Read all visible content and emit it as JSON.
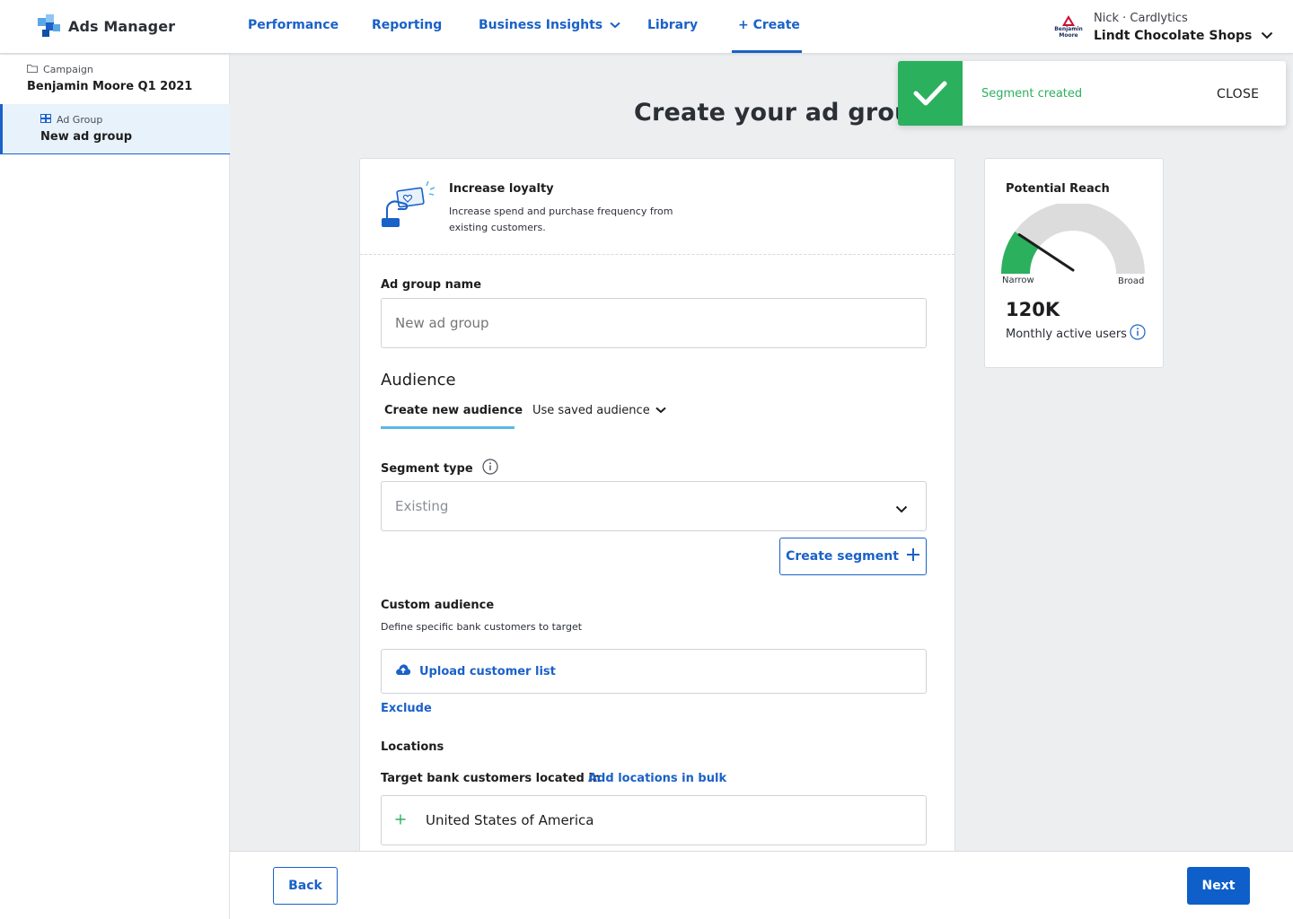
{
  "app": {
    "title": "Ads Manager"
  },
  "nav": {
    "items": [
      {
        "label": "Performance"
      },
      {
        "label": "Reporting"
      },
      {
        "label": "Business Insights"
      },
      {
        "label": "Library"
      },
      {
        "label": "+ Create"
      }
    ]
  },
  "account": {
    "logo_text_1": "Benjamin",
    "logo_text_2": "Moore",
    "user": "Nick · Cardlytics",
    "name": "Lindt Chocolate Shops"
  },
  "sidebar": {
    "campaign_label": "Campaign",
    "campaign_name": "Benjamin Moore Q1 2021",
    "adgroup_label": "Ad Group",
    "adgroup_name": "New ad group"
  },
  "page": {
    "title": "Create your ad group"
  },
  "goal": {
    "title": "Increase loyalty",
    "description": "Increase spend and purchase frequency from existing customers."
  },
  "form": {
    "adgroup_name_label": "Ad group name",
    "adgroup_name_placeholder": "New ad group",
    "audience_heading": "Audience",
    "tabs": [
      {
        "label": "Create new audience",
        "active": true
      },
      {
        "label": "Use saved audience"
      }
    ],
    "segment_type_label": "Segment type",
    "segment_type_value": "Existing",
    "create_segment": "Create segment",
    "custom_audience_label": "Custom audience",
    "custom_audience_desc": "Define specific bank customers to target",
    "upload_label": "Upload customer list",
    "exclude_label": "Exclude",
    "locations_label": "Locations",
    "target_label": "Target bank customers located in",
    "add_bulk_label": "Add locations in bulk",
    "location_value": "United States of America"
  },
  "reach": {
    "title": "Potential Reach",
    "narrow": "Narrow",
    "broad": "Broad",
    "value": "120K",
    "unit": "Monthly active users",
    "level": 0.2
  },
  "footer": {
    "back": "Back",
    "next": "Next"
  },
  "toast": {
    "message": "Segment created",
    "close": "CLOSE"
  },
  "colors": {
    "primary": "#1a61c8",
    "success": "#2bb05d",
    "tab_underline": "#5bb8e6",
    "gauge_track": "#dcdcdc"
  }
}
